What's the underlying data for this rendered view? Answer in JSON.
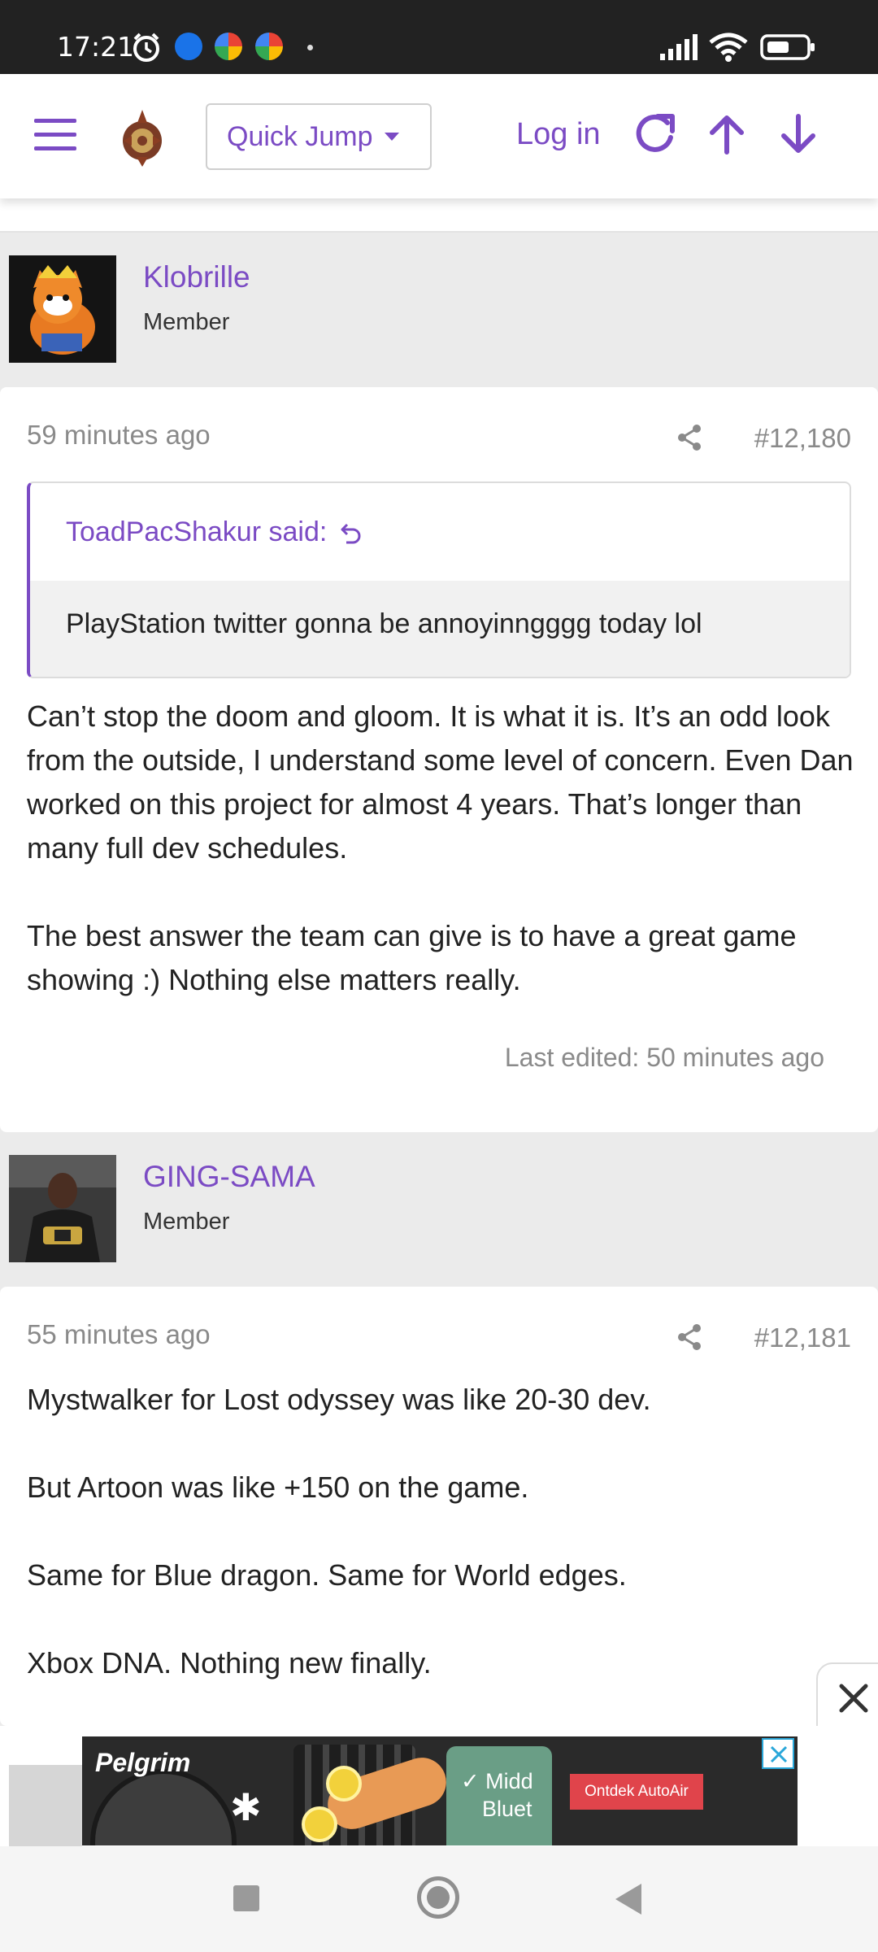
{
  "status_bar": {
    "time": "17:21"
  },
  "header": {
    "quick_jump_label": "Quick Jump",
    "login_label": "Log in"
  },
  "posts": [
    {
      "username": "Klobrille",
      "role": "Member",
      "time": "59 minutes ago",
      "number": "#12,180",
      "quote": {
        "author": "ToadPacShakur said:",
        "text": "PlayStation twitter gonna be annoyinngggg today lol"
      },
      "paragraphs": [
        "Can’t stop the doom and gloom. It is what it is. It’s an odd look from the outside, I understand some level of concern. Even Dan worked on this project for almost 4 years. That’s longer than many full dev schedules.",
        "The best answer the team can give is to have a great game showing :) Nothing else matters really."
      ],
      "last_edited": "Last edited: 50 minutes ago"
    },
    {
      "username": "GING-SAMA",
      "role": "Member",
      "time": "55 minutes ago",
      "number": "#12,181",
      "paragraphs": [
        "Mystwalker for Lost odyssey was like 20-30 dev.",
        "But Artoon was like +150 on the game.",
        "Same for Blue dragon. Same for World edges.",
        "Xbox DNA. Nothing new finally."
      ]
    }
  ],
  "ad": {
    "brand": "Pelgrim",
    "feature_line1": "Midd",
    "feature_line2": "Bluet",
    "cta": "Ontdek AutoAir"
  },
  "colors": {
    "accent": "#7b4bc4",
    "muted": "#8a8a8a",
    "background": "#ebebeb"
  }
}
